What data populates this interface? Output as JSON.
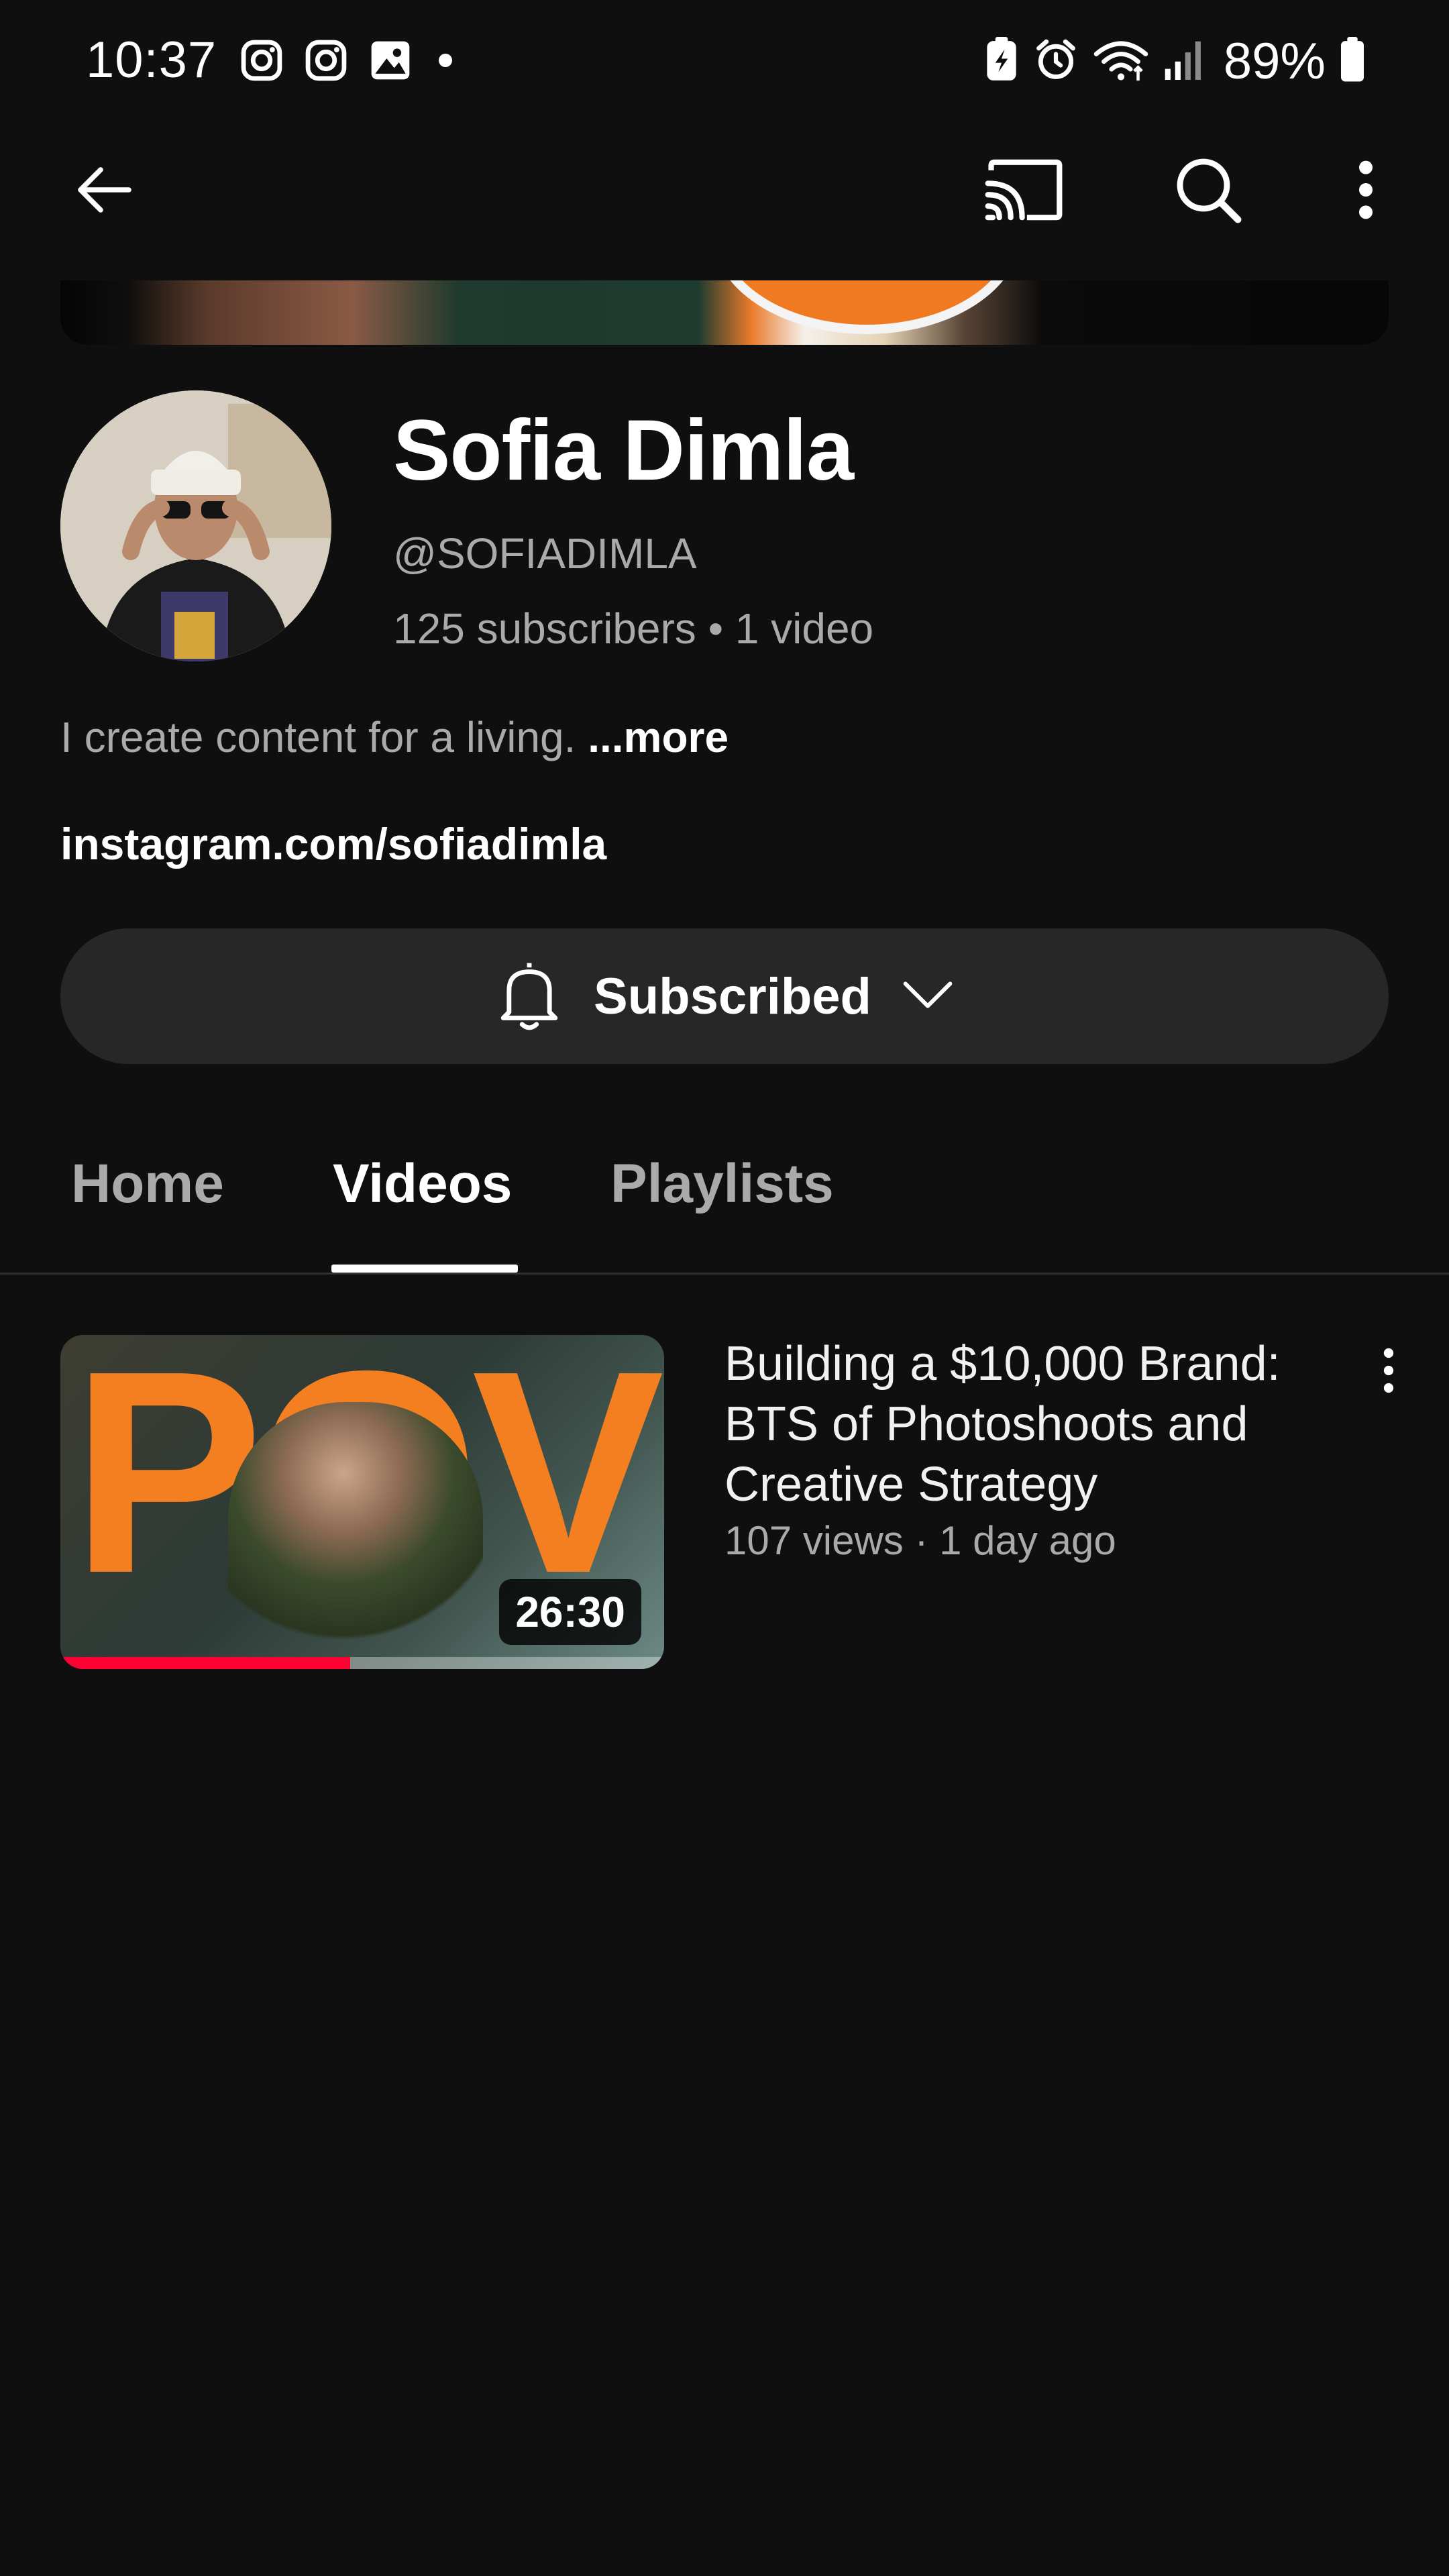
{
  "status_bar": {
    "time": "10:37",
    "battery_percent": "89%",
    "left_icons": [
      "instagram-icon",
      "instagram-icon",
      "gallery-icon",
      "dot-icon"
    ],
    "right_icons": [
      "battery-saver-icon",
      "alarm-icon",
      "wifi-icon",
      "signal-icon",
      "battery-icon"
    ]
  },
  "app_bar": {
    "icons": [
      "back-arrow-icon",
      "cast-icon",
      "search-icon",
      "more-vert-icon"
    ]
  },
  "channel": {
    "name": "Sofia Dimla",
    "handle": "@SOFIADIMLA",
    "stats": "125 subscribers • 1 video",
    "description": "I create content for a living.",
    "more_label": " ...more",
    "link": "instagram.com/sofiadimla"
  },
  "subscribe": {
    "label": "Subscribed",
    "icons": [
      "bell-icon",
      "chevron-down-icon"
    ]
  },
  "tabs": [
    {
      "label": "Home",
      "active": false
    },
    {
      "label": "Videos",
      "active": true
    },
    {
      "label": "Playlists",
      "active": false
    }
  ],
  "videos": [
    {
      "thumbnail_text": "POV",
      "duration": "26:30",
      "watch_progress": 0.48,
      "title": "Building a $10,000 Brand: BTS of Photoshoots and Creative Strategy",
      "meta": "107 views · 1 day ago"
    }
  ],
  "colors": {
    "background": "#0f0f0f",
    "button": "#272727",
    "secondary_text": "#aaaaaa",
    "progress": "#ff0033",
    "thumbnail_accent": "#f47f21"
  }
}
